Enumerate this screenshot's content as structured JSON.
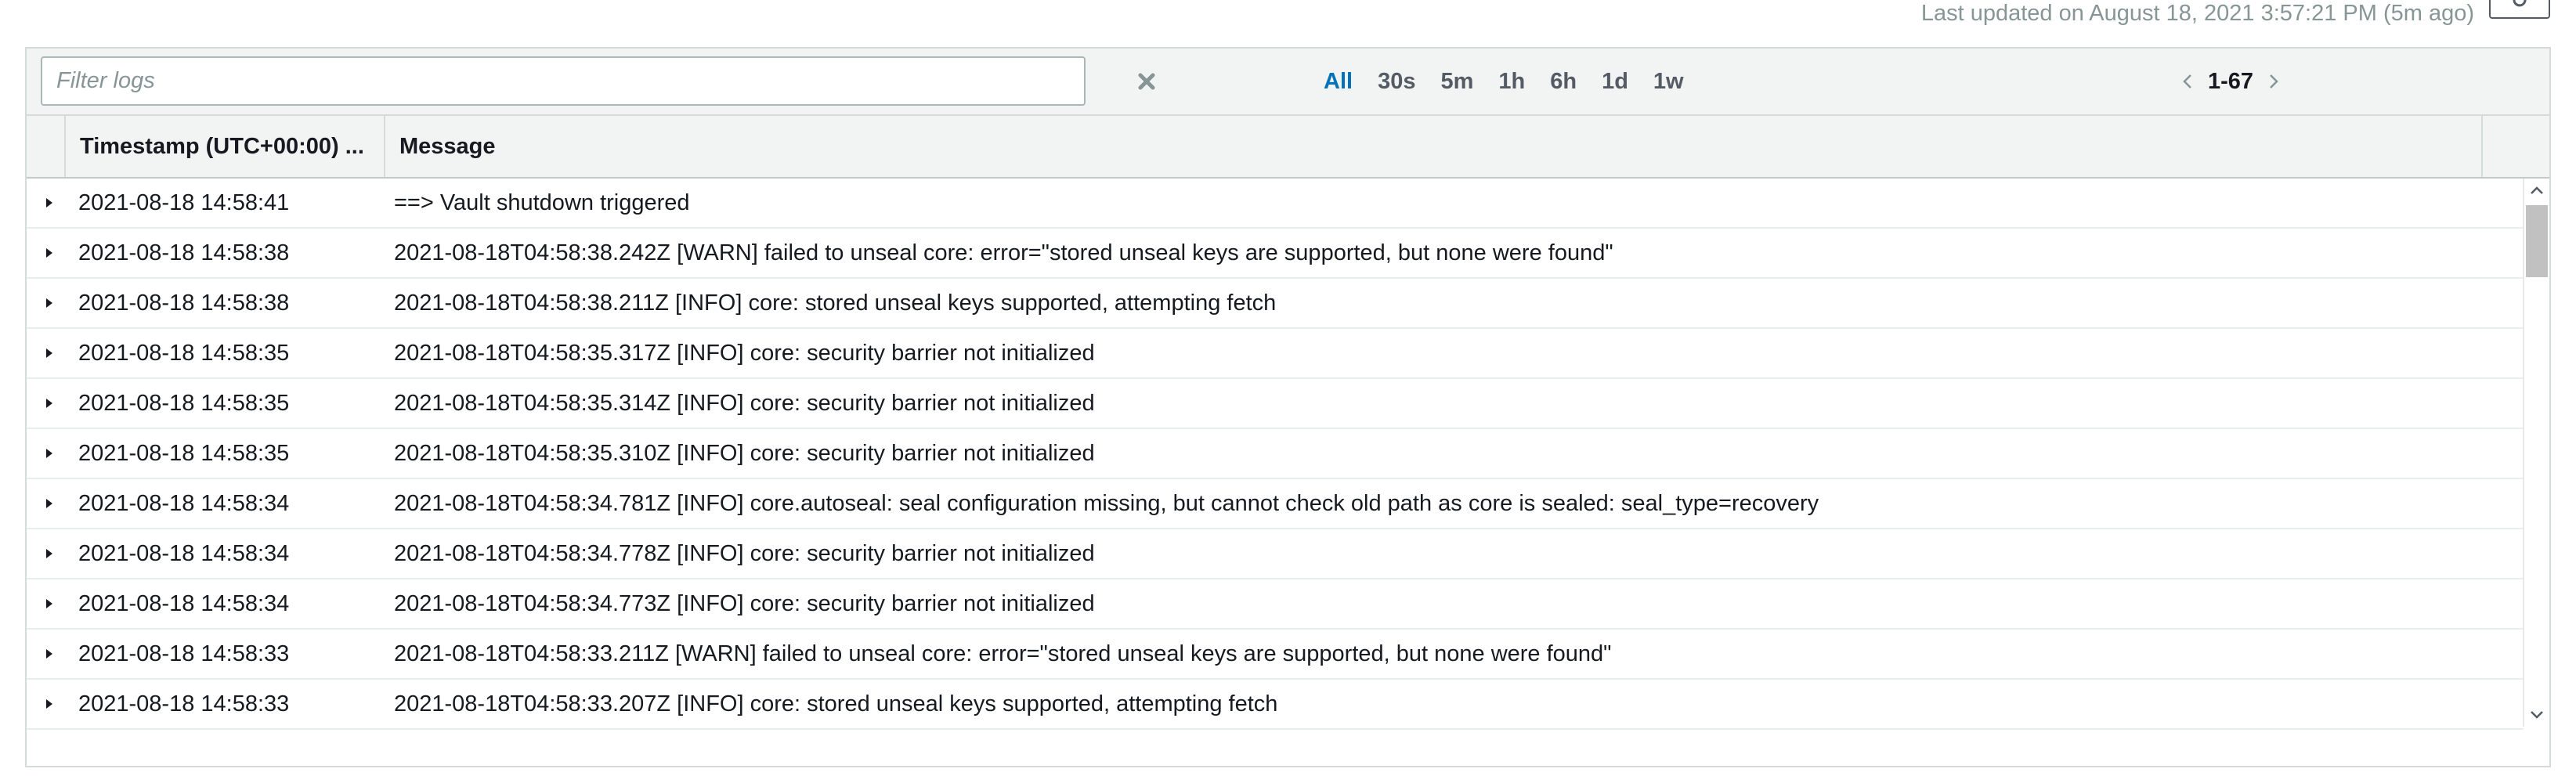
{
  "header": {
    "last_updated": "Last updated on August 18, 2021 3:57:21 PM (5m ago)"
  },
  "toolbar": {
    "filter_placeholder": "Filter logs",
    "filter_value": "",
    "ranges": [
      "All",
      "30s",
      "5m",
      "1h",
      "6h",
      "1d",
      "1w"
    ],
    "active_range": "All",
    "pagination": "1-67"
  },
  "table": {
    "columns": [
      "Timestamp (UTC+00:00) ...",
      "Message"
    ],
    "rows": [
      {
        "timestamp": "2021-08-18 14:58:41",
        "message": "==> Vault shutdown triggered"
      },
      {
        "timestamp": "2021-08-18 14:58:38",
        "message": "2021-08-18T04:58:38.242Z [WARN] failed to unseal core: error=\"stored unseal keys are supported, but none were found\""
      },
      {
        "timestamp": "2021-08-18 14:58:38",
        "message": "2021-08-18T04:58:38.211Z [INFO] core: stored unseal keys supported, attempting fetch"
      },
      {
        "timestamp": "2021-08-18 14:58:35",
        "message": "2021-08-18T04:58:35.317Z [INFO] core: security barrier not initialized"
      },
      {
        "timestamp": "2021-08-18 14:58:35",
        "message": "2021-08-18T04:58:35.314Z [INFO] core: security barrier not initialized"
      },
      {
        "timestamp": "2021-08-18 14:58:35",
        "message": "2021-08-18T04:58:35.310Z [INFO] core: security barrier not initialized"
      },
      {
        "timestamp": "2021-08-18 14:58:34",
        "message": "2021-08-18T04:58:34.781Z [INFO] core.autoseal: seal configuration missing, but cannot check old path as core is sealed: seal_type=recovery"
      },
      {
        "timestamp": "2021-08-18 14:58:34",
        "message": "2021-08-18T04:58:34.778Z [INFO] core: security barrier not initialized"
      },
      {
        "timestamp": "2021-08-18 14:58:34",
        "message": "2021-08-18T04:58:34.773Z [INFO] core: security barrier not initialized"
      },
      {
        "timestamp": "2021-08-18 14:58:33",
        "message": "2021-08-18T04:58:33.211Z [WARN] failed to unseal core: error=\"stored unseal keys are supported, but none were found\""
      },
      {
        "timestamp": "2021-08-18 14:58:33",
        "message": "2021-08-18T04:58:33.207Z [INFO] core: stored unseal keys supported, attempting fetch"
      }
    ]
  },
  "colors": {
    "accent": "#0073bb",
    "header_bg": "#f2f3f3",
    "border": "#d5dbdb",
    "muted_text": "#879596"
  },
  "icons": {
    "refresh": "refresh-icon",
    "clear": "close-icon",
    "prev": "chevron-left-icon",
    "next": "chevron-right-icon",
    "expand": "caret-right-icon"
  }
}
